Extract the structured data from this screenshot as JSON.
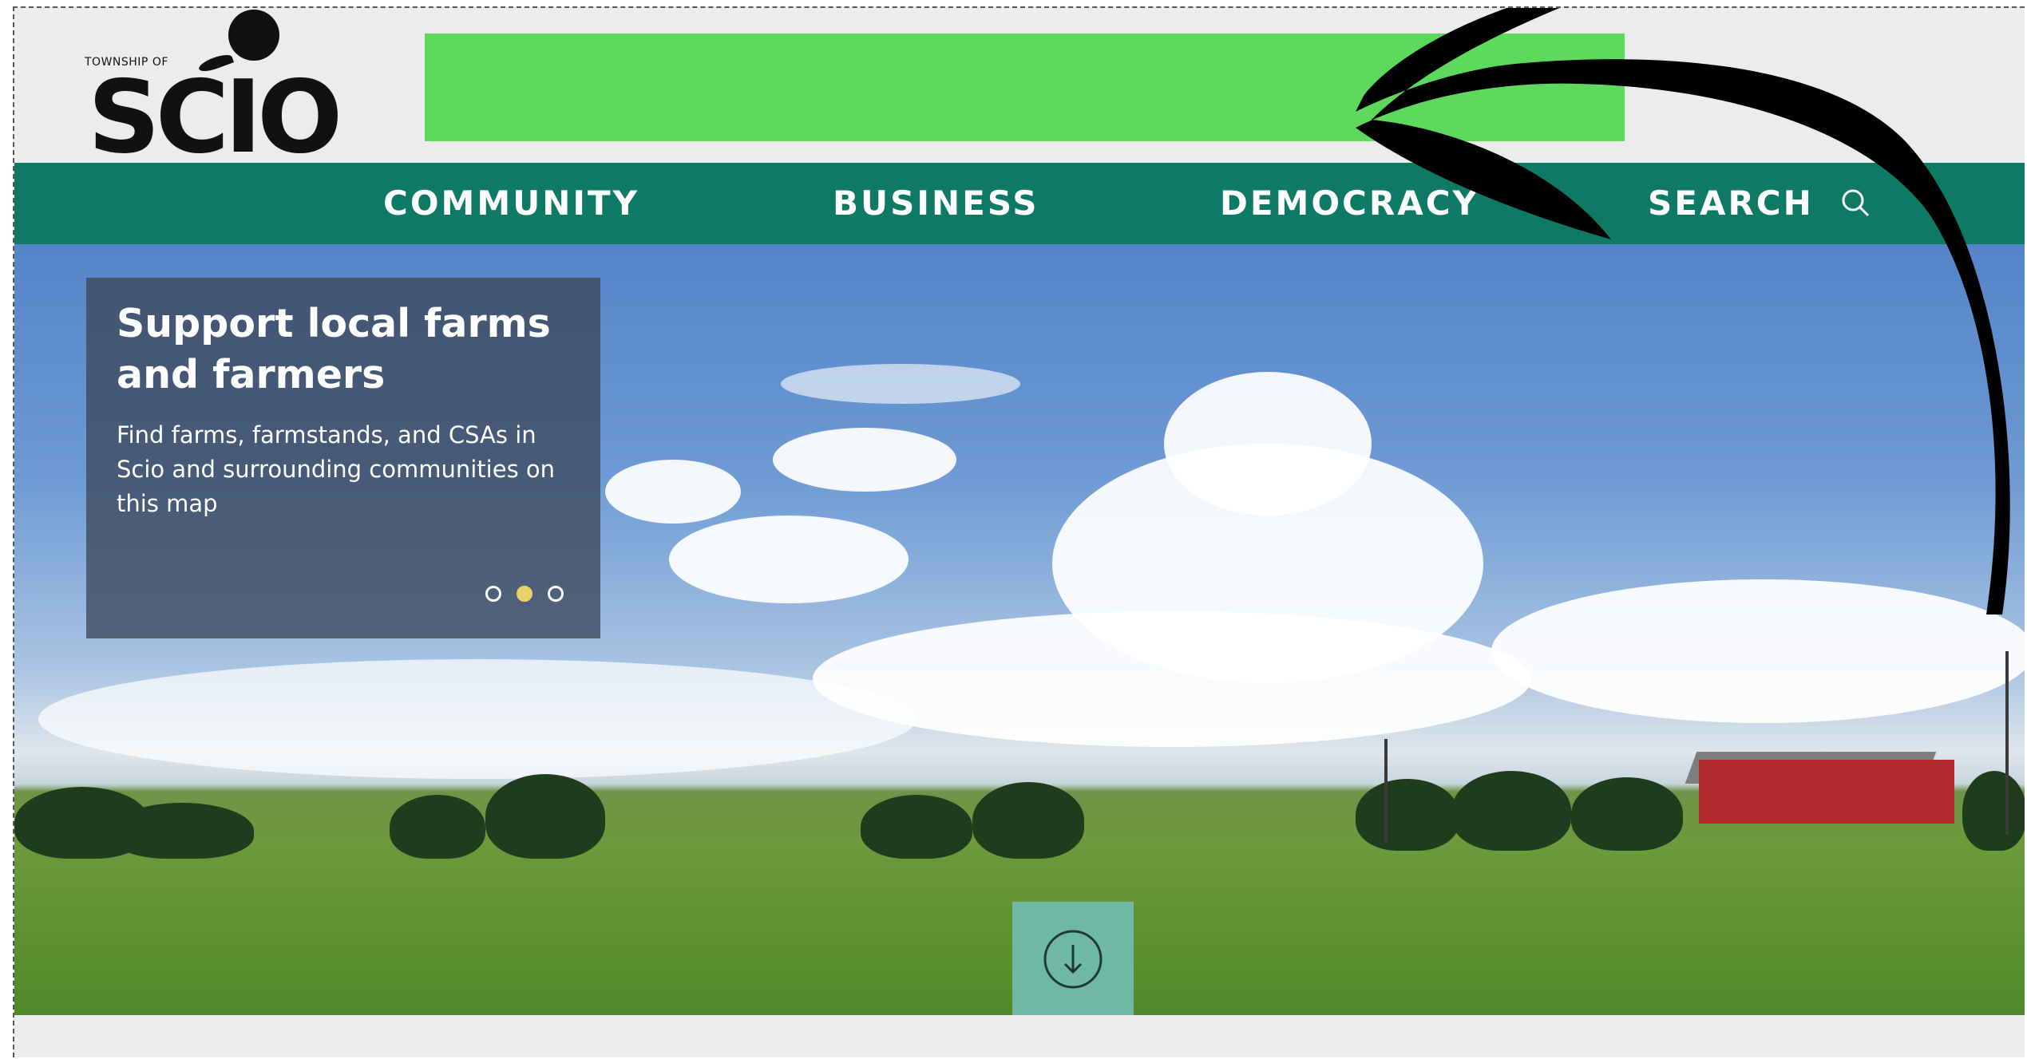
{
  "header": {
    "logo_small": "TOWNSHIP OF",
    "logo_big": "SCIO",
    "banner_color": "#5dd95d"
  },
  "nav": {
    "items": [
      {
        "label": "COMMUNITY"
      },
      {
        "label": "BUSINESS"
      },
      {
        "label": "DEMOCRACY"
      }
    ],
    "search_label": "SEARCH",
    "background": "#0e7a66"
  },
  "hero": {
    "title": "Support local farms and farmers",
    "text": "Find farms, farmstands, and CSAs in Scio and surrounding communities on this map",
    "slides": 3,
    "active_slide": 2,
    "scroll_icon": "arrow-down-circle-icon"
  },
  "annotation": {
    "icon": "curved-arrow-icon",
    "color": "#000000"
  }
}
